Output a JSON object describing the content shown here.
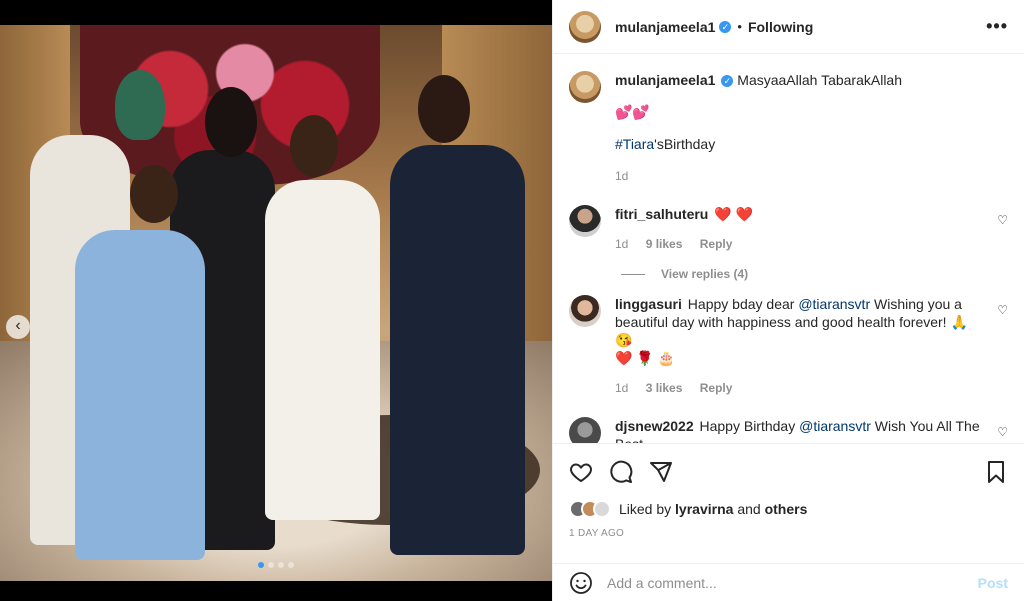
{
  "post": {
    "author": "mulanjameela1",
    "follow_status": "Following",
    "more_label": "•••",
    "caption": "MasyaaAllah TabarakAllah",
    "caption_emoji": "💕💕",
    "hashtag": "#Tiara",
    "hashtag_suffix": "'sBirthday",
    "caption_age": "1d",
    "liked_by_prefix": "Liked by",
    "liked_by_user": "lyravirna",
    "liked_by_and": "and",
    "liked_by_others": "others",
    "time_ago": "1 DAY AGO"
  },
  "carousel": {
    "prev_label": "‹",
    "page": 1,
    "page_count": 4
  },
  "comments": [
    {
      "user": "fitri_salhuteru",
      "text": "",
      "emoji": "❤️ ❤️",
      "age": "1d",
      "likes": "9 likes",
      "reply": "Reply",
      "view_replies": "View replies (4)"
    },
    {
      "user": "linggasuri",
      "text_pre": "Happy bday dear ",
      "mention": "@tiaransvtr",
      "text_post": " Wishing you a beautiful day with happiness and good health forever! 🙏 😘",
      "emoji_line": "❤️ 🌹 🎂",
      "age": "1d",
      "likes": "3 likes",
      "reply": "Reply"
    },
    {
      "user": "djsnew2022",
      "text_pre": "Happy Birthday ",
      "mention": "@tiaransvtr",
      "text_post": " Wish You All The Best"
    }
  ],
  "composer": {
    "placeholder": "Add a comment...",
    "post_label": "Post"
  },
  "colors": {
    "link": "#00376b",
    "verified": "#3897f0",
    "muted": "#8e8e8e",
    "post_disabled": "#b2dffc"
  }
}
